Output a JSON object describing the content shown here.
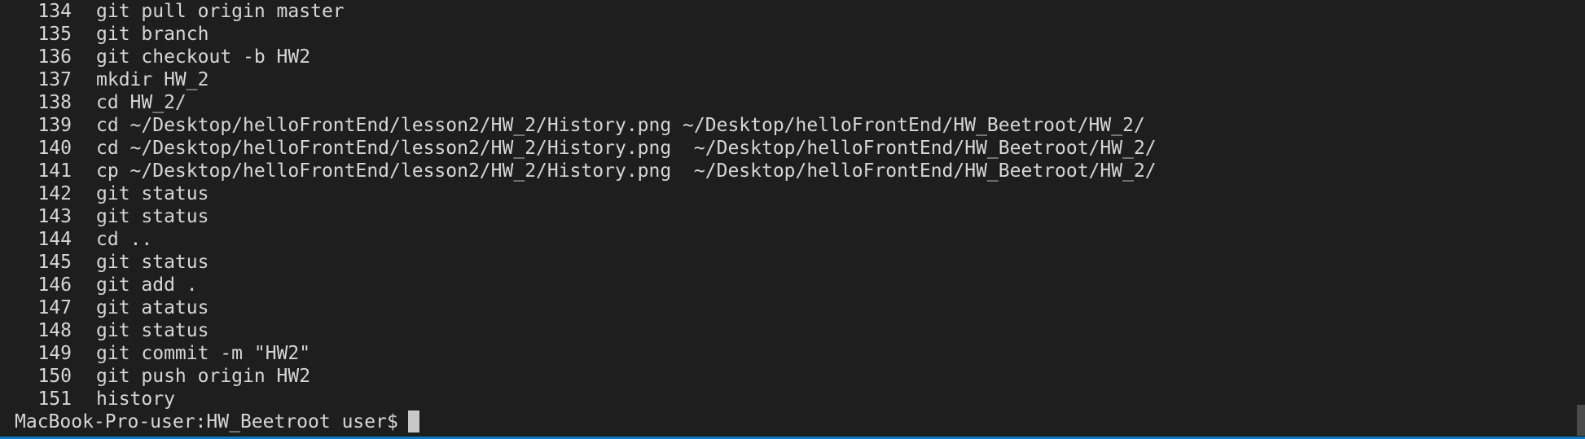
{
  "history": [
    {
      "num": "134",
      "cmd": "git pull origin master"
    },
    {
      "num": "135",
      "cmd": "git branch"
    },
    {
      "num": "136",
      "cmd": "git checkout -b HW2"
    },
    {
      "num": "137",
      "cmd": "mkdir HW_2"
    },
    {
      "num": "138",
      "cmd": "cd HW_2/"
    },
    {
      "num": "139",
      "cmd": "cd ~/Desktop/helloFrontEnd/lesson2/HW_2/History.png ~/Desktop/helloFrontEnd/HW_Beetroot/HW_2/"
    },
    {
      "num": "140",
      "cmd": "cd ~/Desktop/helloFrontEnd/lesson2/HW_2/History.png  ~/Desktop/helloFrontEnd/HW_Beetroot/HW_2/"
    },
    {
      "num": "141",
      "cmd": "cp ~/Desktop/helloFrontEnd/lesson2/HW_2/History.png  ~/Desktop/helloFrontEnd/HW_Beetroot/HW_2/"
    },
    {
      "num": "142",
      "cmd": "git status"
    },
    {
      "num": "143",
      "cmd": "git status"
    },
    {
      "num": "144",
      "cmd": "cd .."
    },
    {
      "num": "145",
      "cmd": "git status"
    },
    {
      "num": "146",
      "cmd": "git add ."
    },
    {
      "num": "147",
      "cmd": "git atatus"
    },
    {
      "num": "148",
      "cmd": "git status"
    },
    {
      "num": "149",
      "cmd": "git commit -m \"HW2\""
    },
    {
      "num": "150",
      "cmd": "git push origin HW2"
    },
    {
      "num": "151",
      "cmd": "history"
    }
  ],
  "prompt": "MacBook-Pro-user:HW_Beetroot user$",
  "colors": {
    "background": "#1e1e1e",
    "text": "#d6d6d6",
    "cursor": "#c8c8c8",
    "focus_border": "#0a7acb"
  }
}
